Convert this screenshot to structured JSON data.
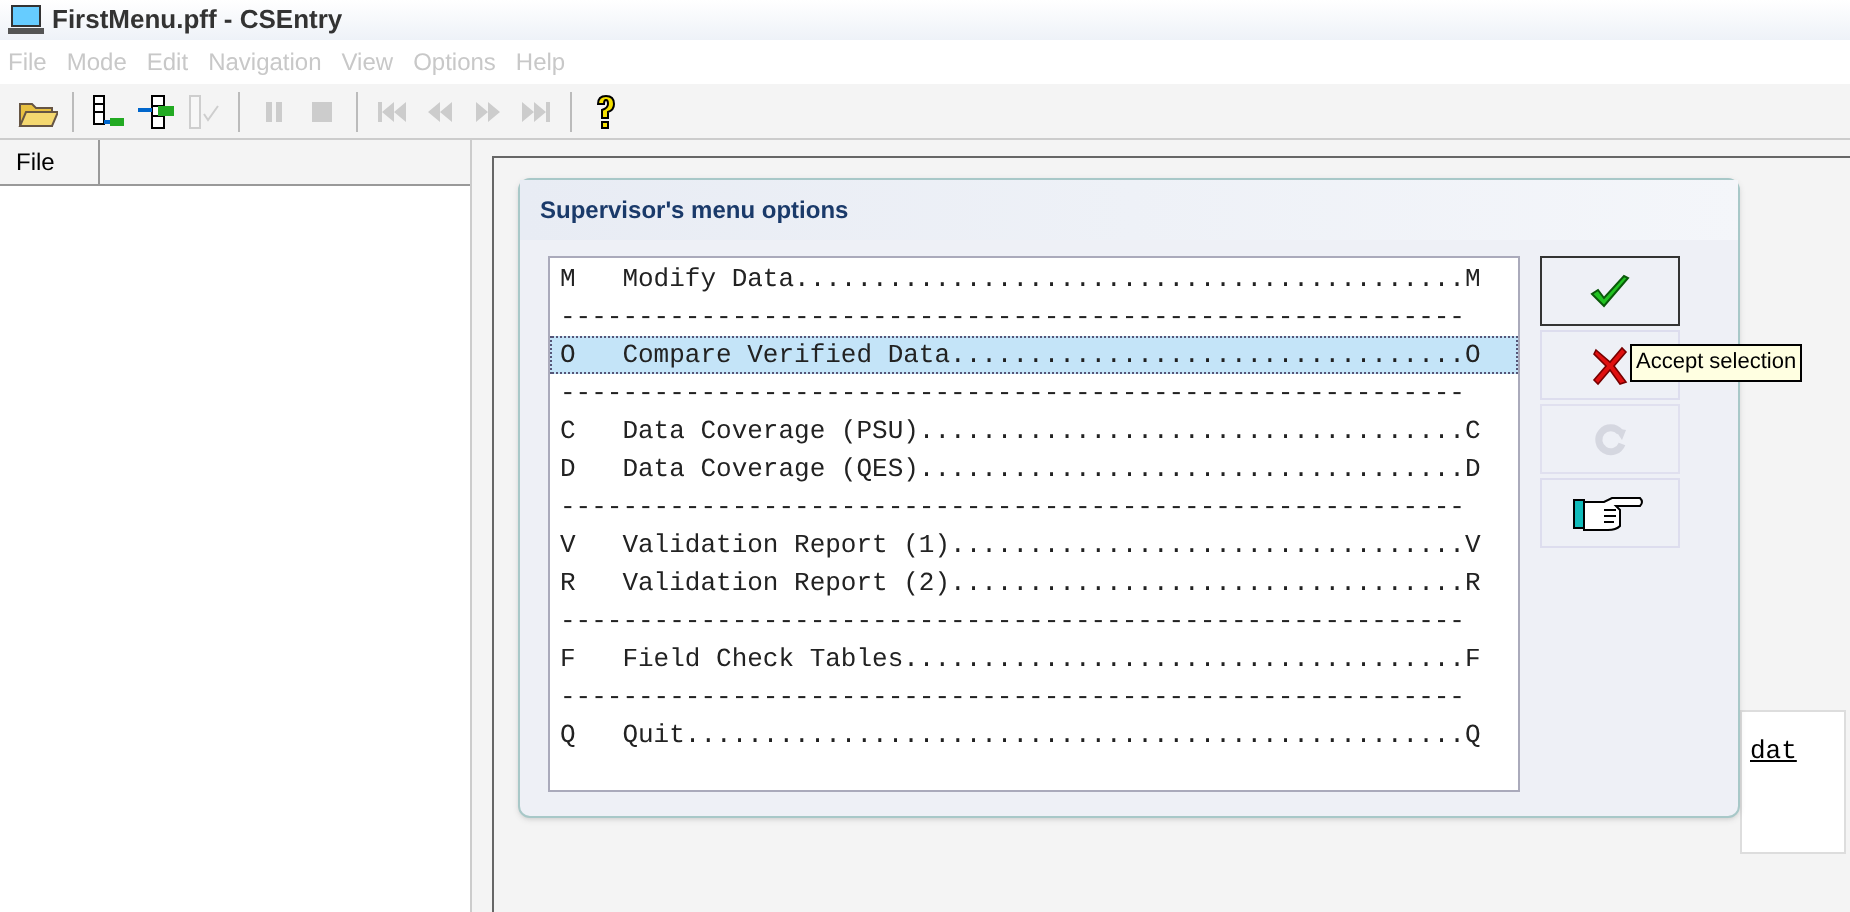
{
  "window": {
    "title": "FirstMenu.pff - CSEntry"
  },
  "menu_bar": [
    {
      "label": "File",
      "disabled": true
    },
    {
      "label": "Mode",
      "disabled": true
    },
    {
      "label": "Edit",
      "disabled": true
    },
    {
      "label": "Navigation",
      "disabled": true
    },
    {
      "label": "View",
      "disabled": true
    },
    {
      "label": "Options",
      "disabled": true
    },
    {
      "label": "Help",
      "disabled": true
    }
  ],
  "left_panel": {
    "tab": "File"
  },
  "dialog": {
    "title": "Supervisor's menu options",
    "lines": [
      {
        "kind": "item",
        "text": "M   Modify Data...........................................M",
        "selected": false
      },
      {
        "kind": "separator",
        "text": "----------------------------------------------------------"
      },
      {
        "kind": "item",
        "text": "O   Compare Verified Data.................................O",
        "selected": true
      },
      {
        "kind": "separator",
        "text": "----------------------------------------------------------"
      },
      {
        "kind": "item",
        "text": "C   Data Coverage (PSU)...................................C",
        "selected": false
      },
      {
        "kind": "item",
        "text": "D   Data Coverage (QES)...................................D",
        "selected": false
      },
      {
        "kind": "separator",
        "text": "----------------------------------------------------------"
      },
      {
        "kind": "item",
        "text": "V   Validation Report (1).................................V",
        "selected": false
      },
      {
        "kind": "item",
        "text": "R   Validation Report (2).................................R",
        "selected": false
      },
      {
        "kind": "separator",
        "text": "----------------------------------------------------------"
      },
      {
        "kind": "item",
        "text": "F   Field Check Tables....................................F",
        "selected": false
      },
      {
        "kind": "separator",
        "text": "----------------------------------------------------------"
      },
      {
        "kind": "item",
        "text": "Q   Quit..................................................Q",
        "selected": false
      }
    ],
    "buttons": [
      {
        "kind": "accept",
        "disabled": false
      },
      {
        "kind": "cancel",
        "disabled": false
      },
      {
        "kind": "refresh",
        "disabled": true
      },
      {
        "kind": "point",
        "disabled": false
      }
    ],
    "tooltip": "Accept selection"
  },
  "background_text": "dat"
}
